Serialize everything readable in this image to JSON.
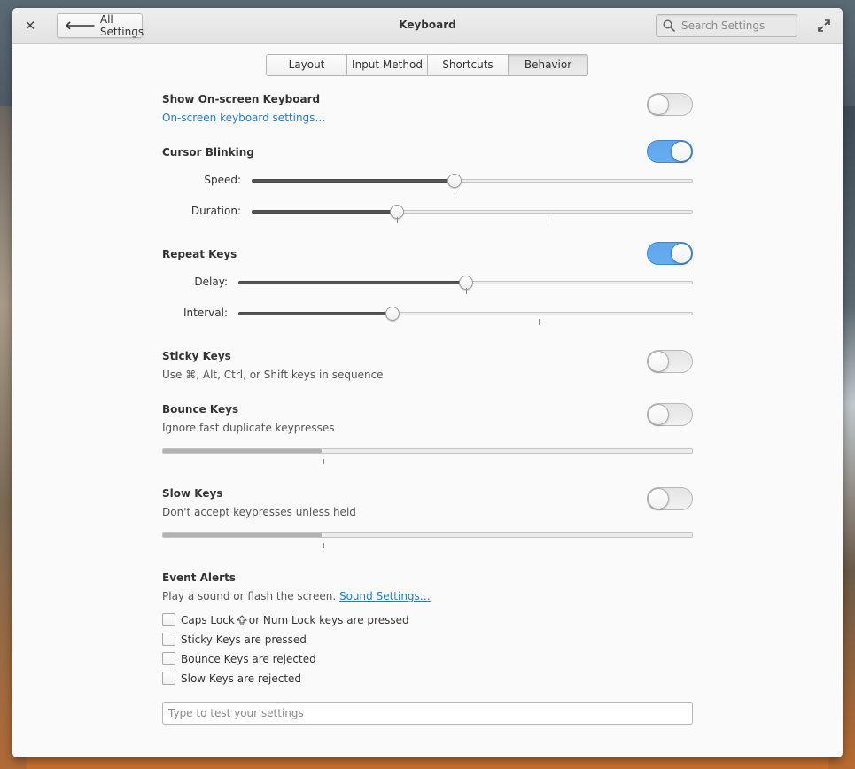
{
  "window": {
    "title": "Keyboard",
    "back_label": "All Settings",
    "search_placeholder": "Search Settings"
  },
  "tabs": [
    {
      "label": "Layout",
      "active": false
    },
    {
      "label": "Input Method",
      "active": false
    },
    {
      "label": "Shortcuts",
      "active": false
    },
    {
      "label": "Behavior",
      "active": true
    }
  ],
  "onscreen": {
    "title": "Show On-screen Keyboard",
    "link": "On-screen keyboard settings…",
    "enabled": false
  },
  "cursor_blinking": {
    "title": "Cursor Blinking",
    "enabled": true,
    "speed_label": "Speed:",
    "speed_value": 0.46,
    "duration_label": "Duration:",
    "duration_value": 0.33
  },
  "repeat_keys": {
    "title": "Repeat Keys",
    "enabled": true,
    "delay_label": "Delay:",
    "delay_value": 0.5,
    "interval_label": "Interval:",
    "interval_value": 0.34
  },
  "sticky_keys": {
    "title": "Sticky Keys",
    "description": "Use ⌘, Alt, Ctrl, or Shift keys in sequence",
    "enabled": false
  },
  "bounce_keys": {
    "title": "Bounce Keys",
    "description": "Ignore fast duplicate keypresses",
    "enabled": false,
    "level": 0.3
  },
  "slow_keys": {
    "title": "Slow Keys",
    "description": "Don't accept keypresses unless held",
    "enabled": false,
    "level": 0.3
  },
  "event_alerts": {
    "title": "Event Alerts",
    "description": "Play a sound or flash the screen.",
    "sound_link": "Sound Settings…",
    "options": [
      {
        "label_before": "Caps Lock",
        "label_after": "or Num Lock keys are pressed",
        "checked": false
      },
      {
        "label": "Sticky Keys are pressed",
        "checked": false
      },
      {
        "label": "Bounce Keys are rejected",
        "checked": false
      },
      {
        "label": "Slow Keys are rejected",
        "checked": false
      }
    ]
  },
  "test_field": {
    "placeholder": "Type to test your settings"
  },
  "colors": {
    "accent": "#64abef",
    "link": "#2a7bc4"
  }
}
